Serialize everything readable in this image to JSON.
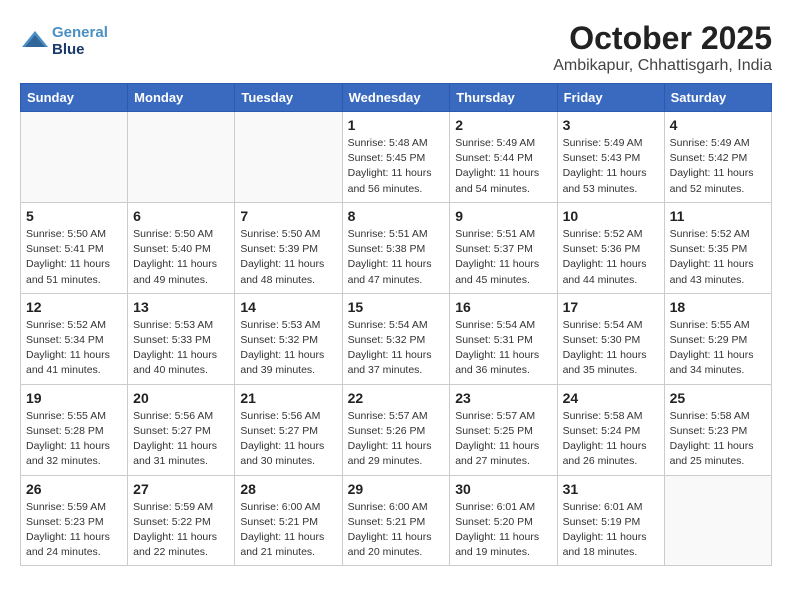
{
  "header": {
    "title": "October 2025",
    "subtitle": "Ambikapur, Chhattisgarh, India",
    "logo_line1": "General",
    "logo_line2": "Blue"
  },
  "weekdays": [
    "Sunday",
    "Monday",
    "Tuesday",
    "Wednesday",
    "Thursday",
    "Friday",
    "Saturday"
  ],
  "weeks": [
    [
      {
        "day": "",
        "info": ""
      },
      {
        "day": "",
        "info": ""
      },
      {
        "day": "",
        "info": ""
      },
      {
        "day": "1",
        "info": "Sunrise: 5:48 AM\nSunset: 5:45 PM\nDaylight: 11 hours\nand 56 minutes."
      },
      {
        "day": "2",
        "info": "Sunrise: 5:49 AM\nSunset: 5:44 PM\nDaylight: 11 hours\nand 54 minutes."
      },
      {
        "day": "3",
        "info": "Sunrise: 5:49 AM\nSunset: 5:43 PM\nDaylight: 11 hours\nand 53 minutes."
      },
      {
        "day": "4",
        "info": "Sunrise: 5:49 AM\nSunset: 5:42 PM\nDaylight: 11 hours\nand 52 minutes."
      }
    ],
    [
      {
        "day": "5",
        "info": "Sunrise: 5:50 AM\nSunset: 5:41 PM\nDaylight: 11 hours\nand 51 minutes."
      },
      {
        "day": "6",
        "info": "Sunrise: 5:50 AM\nSunset: 5:40 PM\nDaylight: 11 hours\nand 49 minutes."
      },
      {
        "day": "7",
        "info": "Sunrise: 5:50 AM\nSunset: 5:39 PM\nDaylight: 11 hours\nand 48 minutes."
      },
      {
        "day": "8",
        "info": "Sunrise: 5:51 AM\nSunset: 5:38 PM\nDaylight: 11 hours\nand 47 minutes."
      },
      {
        "day": "9",
        "info": "Sunrise: 5:51 AM\nSunset: 5:37 PM\nDaylight: 11 hours\nand 45 minutes."
      },
      {
        "day": "10",
        "info": "Sunrise: 5:52 AM\nSunset: 5:36 PM\nDaylight: 11 hours\nand 44 minutes."
      },
      {
        "day": "11",
        "info": "Sunrise: 5:52 AM\nSunset: 5:35 PM\nDaylight: 11 hours\nand 43 minutes."
      }
    ],
    [
      {
        "day": "12",
        "info": "Sunrise: 5:52 AM\nSunset: 5:34 PM\nDaylight: 11 hours\nand 41 minutes."
      },
      {
        "day": "13",
        "info": "Sunrise: 5:53 AM\nSunset: 5:33 PM\nDaylight: 11 hours\nand 40 minutes."
      },
      {
        "day": "14",
        "info": "Sunrise: 5:53 AM\nSunset: 5:32 PM\nDaylight: 11 hours\nand 39 minutes."
      },
      {
        "day": "15",
        "info": "Sunrise: 5:54 AM\nSunset: 5:32 PM\nDaylight: 11 hours\nand 37 minutes."
      },
      {
        "day": "16",
        "info": "Sunrise: 5:54 AM\nSunset: 5:31 PM\nDaylight: 11 hours\nand 36 minutes."
      },
      {
        "day": "17",
        "info": "Sunrise: 5:54 AM\nSunset: 5:30 PM\nDaylight: 11 hours\nand 35 minutes."
      },
      {
        "day": "18",
        "info": "Sunrise: 5:55 AM\nSunset: 5:29 PM\nDaylight: 11 hours\nand 34 minutes."
      }
    ],
    [
      {
        "day": "19",
        "info": "Sunrise: 5:55 AM\nSunset: 5:28 PM\nDaylight: 11 hours\nand 32 minutes."
      },
      {
        "day": "20",
        "info": "Sunrise: 5:56 AM\nSunset: 5:27 PM\nDaylight: 11 hours\nand 31 minutes."
      },
      {
        "day": "21",
        "info": "Sunrise: 5:56 AM\nSunset: 5:27 PM\nDaylight: 11 hours\nand 30 minutes."
      },
      {
        "day": "22",
        "info": "Sunrise: 5:57 AM\nSunset: 5:26 PM\nDaylight: 11 hours\nand 29 minutes."
      },
      {
        "day": "23",
        "info": "Sunrise: 5:57 AM\nSunset: 5:25 PM\nDaylight: 11 hours\nand 27 minutes."
      },
      {
        "day": "24",
        "info": "Sunrise: 5:58 AM\nSunset: 5:24 PM\nDaylight: 11 hours\nand 26 minutes."
      },
      {
        "day": "25",
        "info": "Sunrise: 5:58 AM\nSunset: 5:23 PM\nDaylight: 11 hours\nand 25 minutes."
      }
    ],
    [
      {
        "day": "26",
        "info": "Sunrise: 5:59 AM\nSunset: 5:23 PM\nDaylight: 11 hours\nand 24 minutes."
      },
      {
        "day": "27",
        "info": "Sunrise: 5:59 AM\nSunset: 5:22 PM\nDaylight: 11 hours\nand 22 minutes."
      },
      {
        "day": "28",
        "info": "Sunrise: 6:00 AM\nSunset: 5:21 PM\nDaylight: 11 hours\nand 21 minutes."
      },
      {
        "day": "29",
        "info": "Sunrise: 6:00 AM\nSunset: 5:21 PM\nDaylight: 11 hours\nand 20 minutes."
      },
      {
        "day": "30",
        "info": "Sunrise: 6:01 AM\nSunset: 5:20 PM\nDaylight: 11 hours\nand 19 minutes."
      },
      {
        "day": "31",
        "info": "Sunrise: 6:01 AM\nSunset: 5:19 PM\nDaylight: 11 hours\nand 18 minutes."
      },
      {
        "day": "",
        "info": ""
      }
    ]
  ]
}
